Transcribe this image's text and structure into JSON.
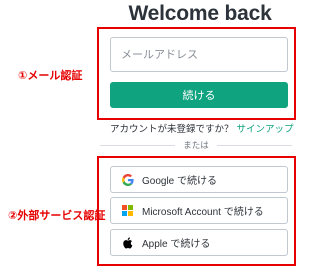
{
  "header": {
    "title": "Welcome back"
  },
  "annotations": {
    "email_auth": "①メール認証",
    "external_auth": "②外部サービス認証"
  },
  "email_form": {
    "placeholder": "メールアドレス",
    "continue_label": "続ける"
  },
  "signup": {
    "prompt": "アカウントが未登録ですか？",
    "link_label": "サインアップ"
  },
  "divider": {
    "label": "または"
  },
  "social": {
    "google_label": "Google で続ける",
    "microsoft_label": "Microsoft Account で続ける",
    "apple_label": "Apple で続ける"
  },
  "colors": {
    "accent": "#10a37f",
    "annotation": "#e60000",
    "text": "#2d333a"
  },
  "icons": {
    "google": "google-icon",
    "microsoft": "microsoft-icon",
    "apple": "apple-icon"
  }
}
